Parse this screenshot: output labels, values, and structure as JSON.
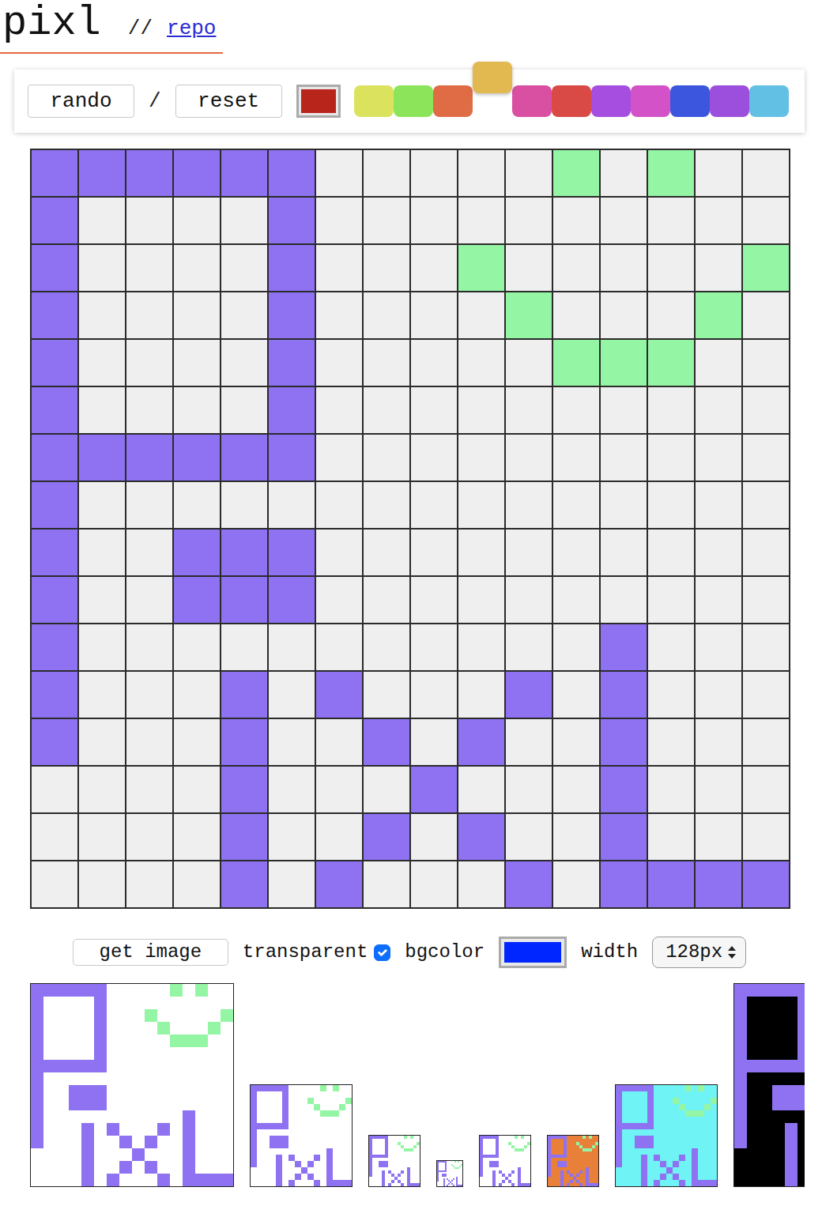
{
  "header": {
    "title": "pixl",
    "separator": "//",
    "link": "repo"
  },
  "toolbar": {
    "buttons": [
      "rando",
      "reset"
    ],
    "divider": "/",
    "current_color": "#b8251a",
    "palette": [
      {
        "color": "#dbe35e",
        "selected": false
      },
      {
        "color": "#8ce45a",
        "selected": false
      },
      {
        "color": "#e06c45",
        "selected": false
      },
      {
        "color": "#e2b851",
        "selected": true
      },
      {
        "color": "#d94fa2",
        "selected": false
      },
      {
        "color": "#d94a47",
        "selected": false
      },
      {
        "color": "#a54ee0",
        "selected": false
      },
      {
        "color": "#d452c8",
        "selected": false
      },
      {
        "color": "#3c57de",
        "selected": false
      },
      {
        "color": "#9b4fdc",
        "selected": false
      },
      {
        "color": "#62c0e4",
        "selected": false
      }
    ]
  },
  "grid": {
    "rows": [
      [
        "#8e72f2",
        "#8e72f2",
        "#8e72f2",
        "#8e72f2",
        "#8e72f2",
        "#8e72f2",
        null,
        null,
        null,
        null,
        null,
        "#94f5a4",
        null,
        "#94f5a4",
        null,
        null
      ],
      [
        "#8e72f2",
        null,
        null,
        null,
        null,
        "#8e72f2",
        null,
        null,
        null,
        null,
        null,
        null,
        null,
        null,
        null,
        null
      ],
      [
        "#8e72f2",
        null,
        null,
        null,
        null,
        "#8e72f2",
        null,
        null,
        null,
        "#94f5a4",
        null,
        null,
        null,
        null,
        null,
        "#94f5a4"
      ],
      [
        "#8e72f2",
        null,
        null,
        null,
        null,
        "#8e72f2",
        null,
        null,
        null,
        null,
        "#94f5a4",
        null,
        null,
        null,
        "#94f5a4",
        null
      ],
      [
        "#8e72f2",
        null,
        null,
        null,
        null,
        "#8e72f2",
        null,
        null,
        null,
        null,
        null,
        "#94f5a4",
        "#94f5a4",
        "#94f5a4",
        null,
        null
      ],
      [
        "#8e72f2",
        null,
        null,
        null,
        null,
        "#8e72f2",
        null,
        null,
        null,
        null,
        null,
        null,
        null,
        null,
        null,
        null
      ],
      [
        "#8e72f2",
        "#8e72f2",
        "#8e72f2",
        "#8e72f2",
        "#8e72f2",
        "#8e72f2",
        null,
        null,
        null,
        null,
        null,
        null,
        null,
        null,
        null,
        null
      ],
      [
        "#8e72f2",
        null,
        null,
        null,
        null,
        null,
        null,
        null,
        null,
        null,
        null,
        null,
        null,
        null,
        null,
        null
      ],
      [
        "#8e72f2",
        null,
        null,
        "#8e72f2",
        "#8e72f2",
        "#8e72f2",
        null,
        null,
        null,
        null,
        null,
        null,
        null,
        null,
        null,
        null
      ],
      [
        "#8e72f2",
        null,
        null,
        "#8e72f2",
        "#8e72f2",
        "#8e72f2",
        null,
        null,
        null,
        null,
        null,
        null,
        null,
        null,
        null,
        null
      ],
      [
        "#8e72f2",
        null,
        null,
        null,
        null,
        null,
        null,
        null,
        null,
        null,
        null,
        null,
        "#8e72f2",
        null,
        null,
        null
      ],
      [
        "#8e72f2",
        null,
        null,
        null,
        "#8e72f2",
        null,
        "#8e72f2",
        null,
        null,
        null,
        "#8e72f2",
        null,
        "#8e72f2",
        null,
        null,
        null
      ],
      [
        "#8e72f2",
        null,
        null,
        null,
        "#8e72f2",
        null,
        null,
        "#8e72f2",
        null,
        "#8e72f2",
        null,
        null,
        "#8e72f2",
        null,
        null,
        null
      ],
      [
        null,
        null,
        null,
        null,
        "#8e72f2",
        null,
        null,
        null,
        "#8e72f2",
        null,
        null,
        null,
        "#8e72f2",
        null,
        null,
        null
      ],
      [
        null,
        null,
        null,
        null,
        "#8e72f2",
        null,
        null,
        "#8e72f2",
        null,
        "#8e72f2",
        null,
        null,
        "#8e72f2",
        null,
        null,
        null
      ],
      [
        null,
        null,
        null,
        null,
        "#8e72f2",
        null,
        "#8e72f2",
        null,
        null,
        null,
        "#8e72f2",
        null,
        "#8e72f2",
        "#8e72f2",
        "#8e72f2",
        "#8e72f2"
      ]
    ]
  },
  "export": {
    "button": "get image",
    "transparent": {
      "label": "transparent",
      "checked": true
    },
    "bgcolor": {
      "label": "bgcolor",
      "color": "#0026ff"
    },
    "width": {
      "label": "width",
      "value": "128px"
    }
  },
  "thumbnails": [
    {
      "kind": "large",
      "background": "#ffffff"
    },
    {
      "kind": "medium",
      "background": "#ffffff"
    },
    {
      "kind": "small",
      "background": "#ffffff"
    },
    {
      "kind": "tiny",
      "background": "#ffffff"
    },
    {
      "kind": "small",
      "background": "#ffffff"
    },
    {
      "kind": "small",
      "background": "#e8803a"
    },
    {
      "kind": "medium",
      "background": "#6ff3f5"
    },
    {
      "kind": "large",
      "background": "#000000"
    }
  ]
}
